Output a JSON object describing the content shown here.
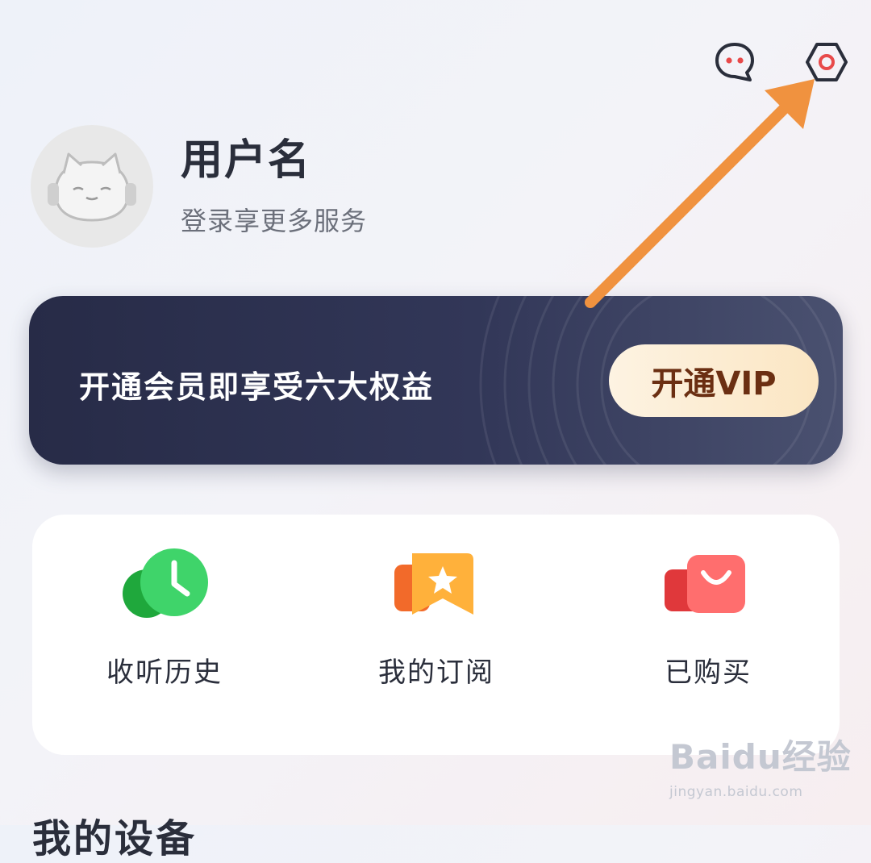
{
  "header": {
    "message_icon": "chat-bubble-icon",
    "settings_icon": "settings-hexagon-icon"
  },
  "profile": {
    "username": "用户名",
    "login_hint": "登录享更多服务",
    "avatar_icon": "cat-headphones-avatar"
  },
  "vip": {
    "promo_text": "开通会员即享受六大权益",
    "button_label": "开通VIP"
  },
  "shortcuts": [
    {
      "label": "收听历史",
      "icon": "clock-green-icon"
    },
    {
      "label": "我的订阅",
      "icon": "star-bookmark-icon"
    },
    {
      "label": "已购买",
      "icon": "shopping-bag-icon"
    }
  ],
  "section": {
    "my_devices": "我的设备"
  },
  "watermark": {
    "brand": "Baidu经验",
    "url": "jingyan.baidu.com"
  },
  "colors": {
    "vip_banner": "#2c3150",
    "vip_button": "#fcecd0",
    "annotation_arrow": "#f0923f",
    "settings_accent": "#e84a4a"
  }
}
